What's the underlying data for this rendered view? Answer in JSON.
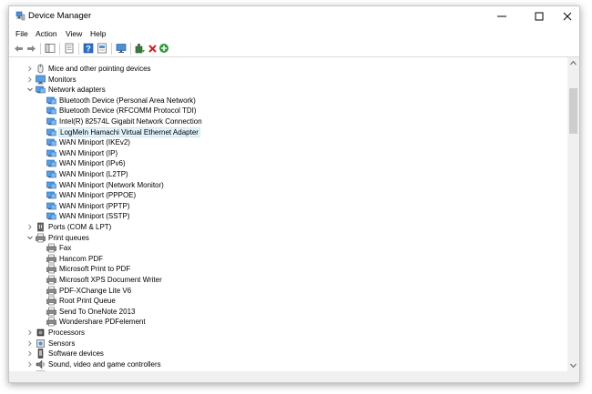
{
  "window": {
    "title": "Device Manager"
  },
  "menu": [
    "File",
    "Action",
    "View",
    "Help"
  ],
  "toolbar_icons": [
    "back-icon",
    "forward-icon",
    "show-hide-icon",
    "properties-icon",
    "help-icon",
    "device-view-icon",
    "monitor-icon",
    "update-driver-icon",
    "uninstall-icon",
    "enable-device-icon"
  ],
  "tree": [
    {
      "label": "Mice and other pointing devices",
      "level": 0,
      "expanded": false,
      "icon": "mouse-icon"
    },
    {
      "label": "Monitors",
      "level": 0,
      "expanded": false,
      "icon": "monitor-icon"
    },
    {
      "label": "Network adapters",
      "level": 0,
      "expanded": true,
      "icon": "network-icon"
    },
    {
      "label": "Bluetooth Device (Personal Area Network)",
      "level": 1,
      "icon": "network-icon"
    },
    {
      "label": "Bluetooth Device (RFCOMM Protocol TDI)",
      "level": 1,
      "icon": "network-icon"
    },
    {
      "label": "Intel(R) 82574L Gigabit Network Connection",
      "level": 1,
      "icon": "network-icon"
    },
    {
      "label": "LogMeIn Hamachi Virtual Ethernet Adapter",
      "level": 1,
      "icon": "network-icon",
      "selected": true
    },
    {
      "label": "WAN Miniport (IKEv2)",
      "level": 1,
      "icon": "network-icon"
    },
    {
      "label": "WAN Miniport (IP)",
      "level": 1,
      "icon": "network-icon"
    },
    {
      "label": "WAN Miniport (IPv6)",
      "level": 1,
      "icon": "network-icon"
    },
    {
      "label": "WAN Miniport (L2TP)",
      "level": 1,
      "icon": "network-icon"
    },
    {
      "label": "WAN Miniport (Network Monitor)",
      "level": 1,
      "icon": "network-icon"
    },
    {
      "label": "WAN Miniport (PPPOE)",
      "level": 1,
      "icon": "network-icon"
    },
    {
      "label": "WAN Miniport (PPTP)",
      "level": 1,
      "icon": "network-icon"
    },
    {
      "label": "WAN Miniport (SSTP)",
      "level": 1,
      "icon": "network-icon"
    },
    {
      "label": "Ports (COM & LPT)",
      "level": 0,
      "expanded": false,
      "icon": "port-icon"
    },
    {
      "label": "Print queues",
      "level": 0,
      "expanded": true,
      "icon": "printer-icon"
    },
    {
      "label": "Fax",
      "level": 1,
      "icon": "printer-icon"
    },
    {
      "label": "Hancom PDF",
      "level": 1,
      "icon": "printer-icon"
    },
    {
      "label": "Microsoft Print to PDF",
      "level": 1,
      "icon": "printer-icon"
    },
    {
      "label": "Microsoft XPS Document Writer",
      "level": 1,
      "icon": "printer-icon"
    },
    {
      "label": "PDF-XChange Lite V6",
      "level": 1,
      "icon": "printer-icon"
    },
    {
      "label": "Root Print Queue",
      "level": 1,
      "icon": "printer-icon"
    },
    {
      "label": "Send To OneNote 2013",
      "level": 1,
      "icon": "printer-icon"
    },
    {
      "label": "Wondershare PDFelement",
      "level": 1,
      "icon": "printer-icon"
    },
    {
      "label": "Processors",
      "level": 0,
      "expanded": false,
      "icon": "processor-icon"
    },
    {
      "label": "Sensors",
      "level": 0,
      "expanded": false,
      "icon": "sensor-icon"
    },
    {
      "label": "Software devices",
      "level": 0,
      "expanded": false,
      "icon": "software-device-icon"
    },
    {
      "label": "Sound, video and game controllers",
      "level": 0,
      "expanded": false,
      "icon": "sound-icon"
    },
    {
      "label": "Storage controllers",
      "level": 0,
      "expanded": false,
      "icon": "storage-icon"
    }
  ]
}
